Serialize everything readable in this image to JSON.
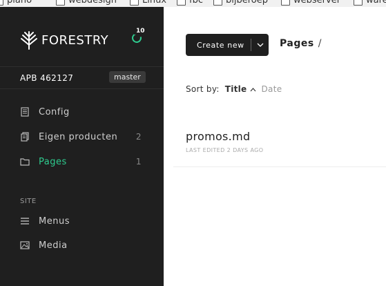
{
  "bookmarks": [
    {
      "label": "piano"
    },
    {
      "label": "webdesign"
    },
    {
      "label": "Linux"
    },
    {
      "label": "fbc"
    },
    {
      "label": "bijberoep"
    },
    {
      "label": "webserver"
    },
    {
      "label": "ware"
    }
  ],
  "sidebar": {
    "logo": "FORESTRY",
    "sync_count": "10",
    "site_name": "APB 462127",
    "branch": "master",
    "items": [
      {
        "label": "Config",
        "count": "",
        "icon": "document-icon"
      },
      {
        "label": "Eigen producten",
        "count": "2",
        "icon": "documents-icon"
      },
      {
        "label": "Pages",
        "count": "1",
        "icon": "folder-icon"
      }
    ],
    "site_section_label": "SITE",
    "site_items": [
      {
        "label": "Menus",
        "icon": "menu-icon"
      },
      {
        "label": "Media",
        "icon": "image-icon"
      }
    ],
    "accent": "#2ecc8f"
  },
  "main": {
    "create_label": "Create new",
    "breadcrumb": "Pages",
    "breadcrumb_sep": "/",
    "sort_label": "Sort by:",
    "sort_title": "Title",
    "sort_date": "Date",
    "documents": [
      {
        "title": "promos.md",
        "meta": "LAST EDITED 2 DAYS AGO"
      }
    ]
  }
}
